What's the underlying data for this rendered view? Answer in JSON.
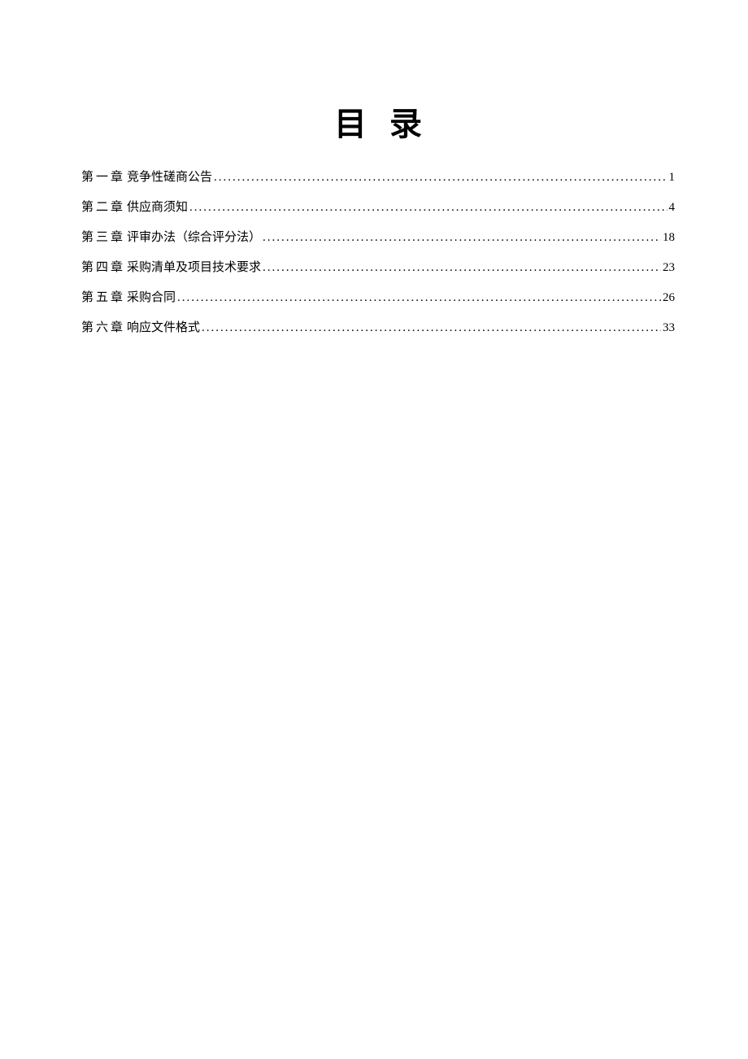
{
  "title": "目录",
  "toc": {
    "entries": [
      {
        "chapter": "第一章",
        "label": "竞争性磋商公告",
        "page": "1"
      },
      {
        "chapter": "第二章",
        "label": "供应商须知",
        "page": "4"
      },
      {
        "chapter": "第三章",
        "label": "评审办法（综合评分法）",
        "page": "18"
      },
      {
        "chapter": "第四章",
        "label": "采购清单及项目技术要求",
        "page": "23"
      },
      {
        "chapter": "第五章",
        "label": "采购合同",
        "page": "26"
      },
      {
        "chapter": "第六章",
        "label": " 响应文件格式",
        "page": "33"
      }
    ]
  }
}
